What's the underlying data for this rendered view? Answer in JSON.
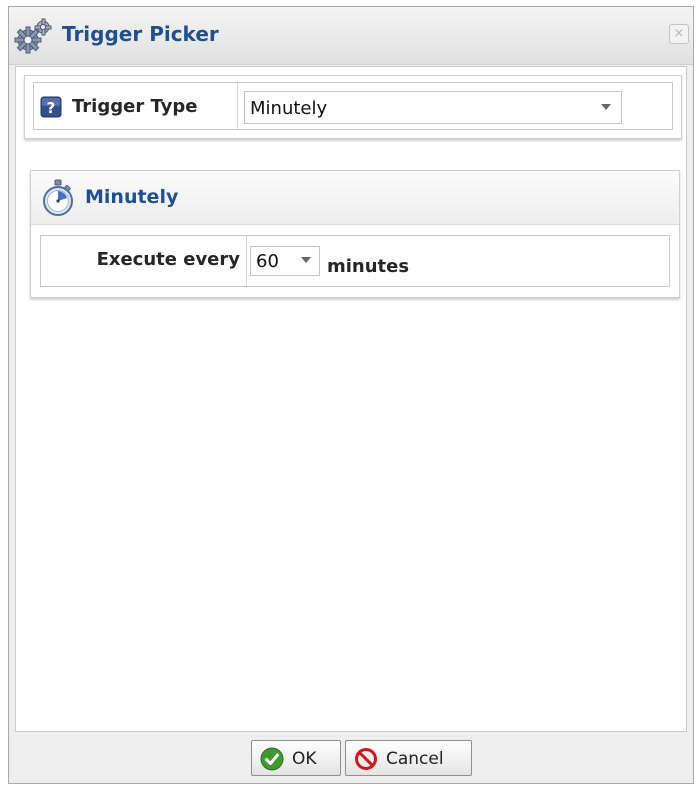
{
  "dialog": {
    "title": "Trigger Picker",
    "close_symbol": "×",
    "icons": {
      "title": "gears-icon",
      "close": "close-icon"
    }
  },
  "trigger_type": {
    "label": "Trigger Type",
    "value": "Minutely",
    "icons": {
      "help": "help-icon",
      "dropdown": "chevron-down-icon"
    }
  },
  "minutely_panel": {
    "title": "Minutely",
    "execute_label": "Execute every",
    "interval_value": "60",
    "unit_label": "minutes",
    "icons": {
      "header": "stopwatch-icon",
      "dropdown": "chevron-down-icon"
    }
  },
  "footer": {
    "ok_label": "OK",
    "cancel_label": "Cancel",
    "icons": {
      "ok": "check-circle-icon",
      "cancel": "prohibited-icon"
    }
  },
  "colors": {
    "title_text": "#1e4f8f",
    "window_background": "#eeeeee",
    "ok_icon": "#3f9b2f",
    "cancel_icon": "#d0161c"
  }
}
